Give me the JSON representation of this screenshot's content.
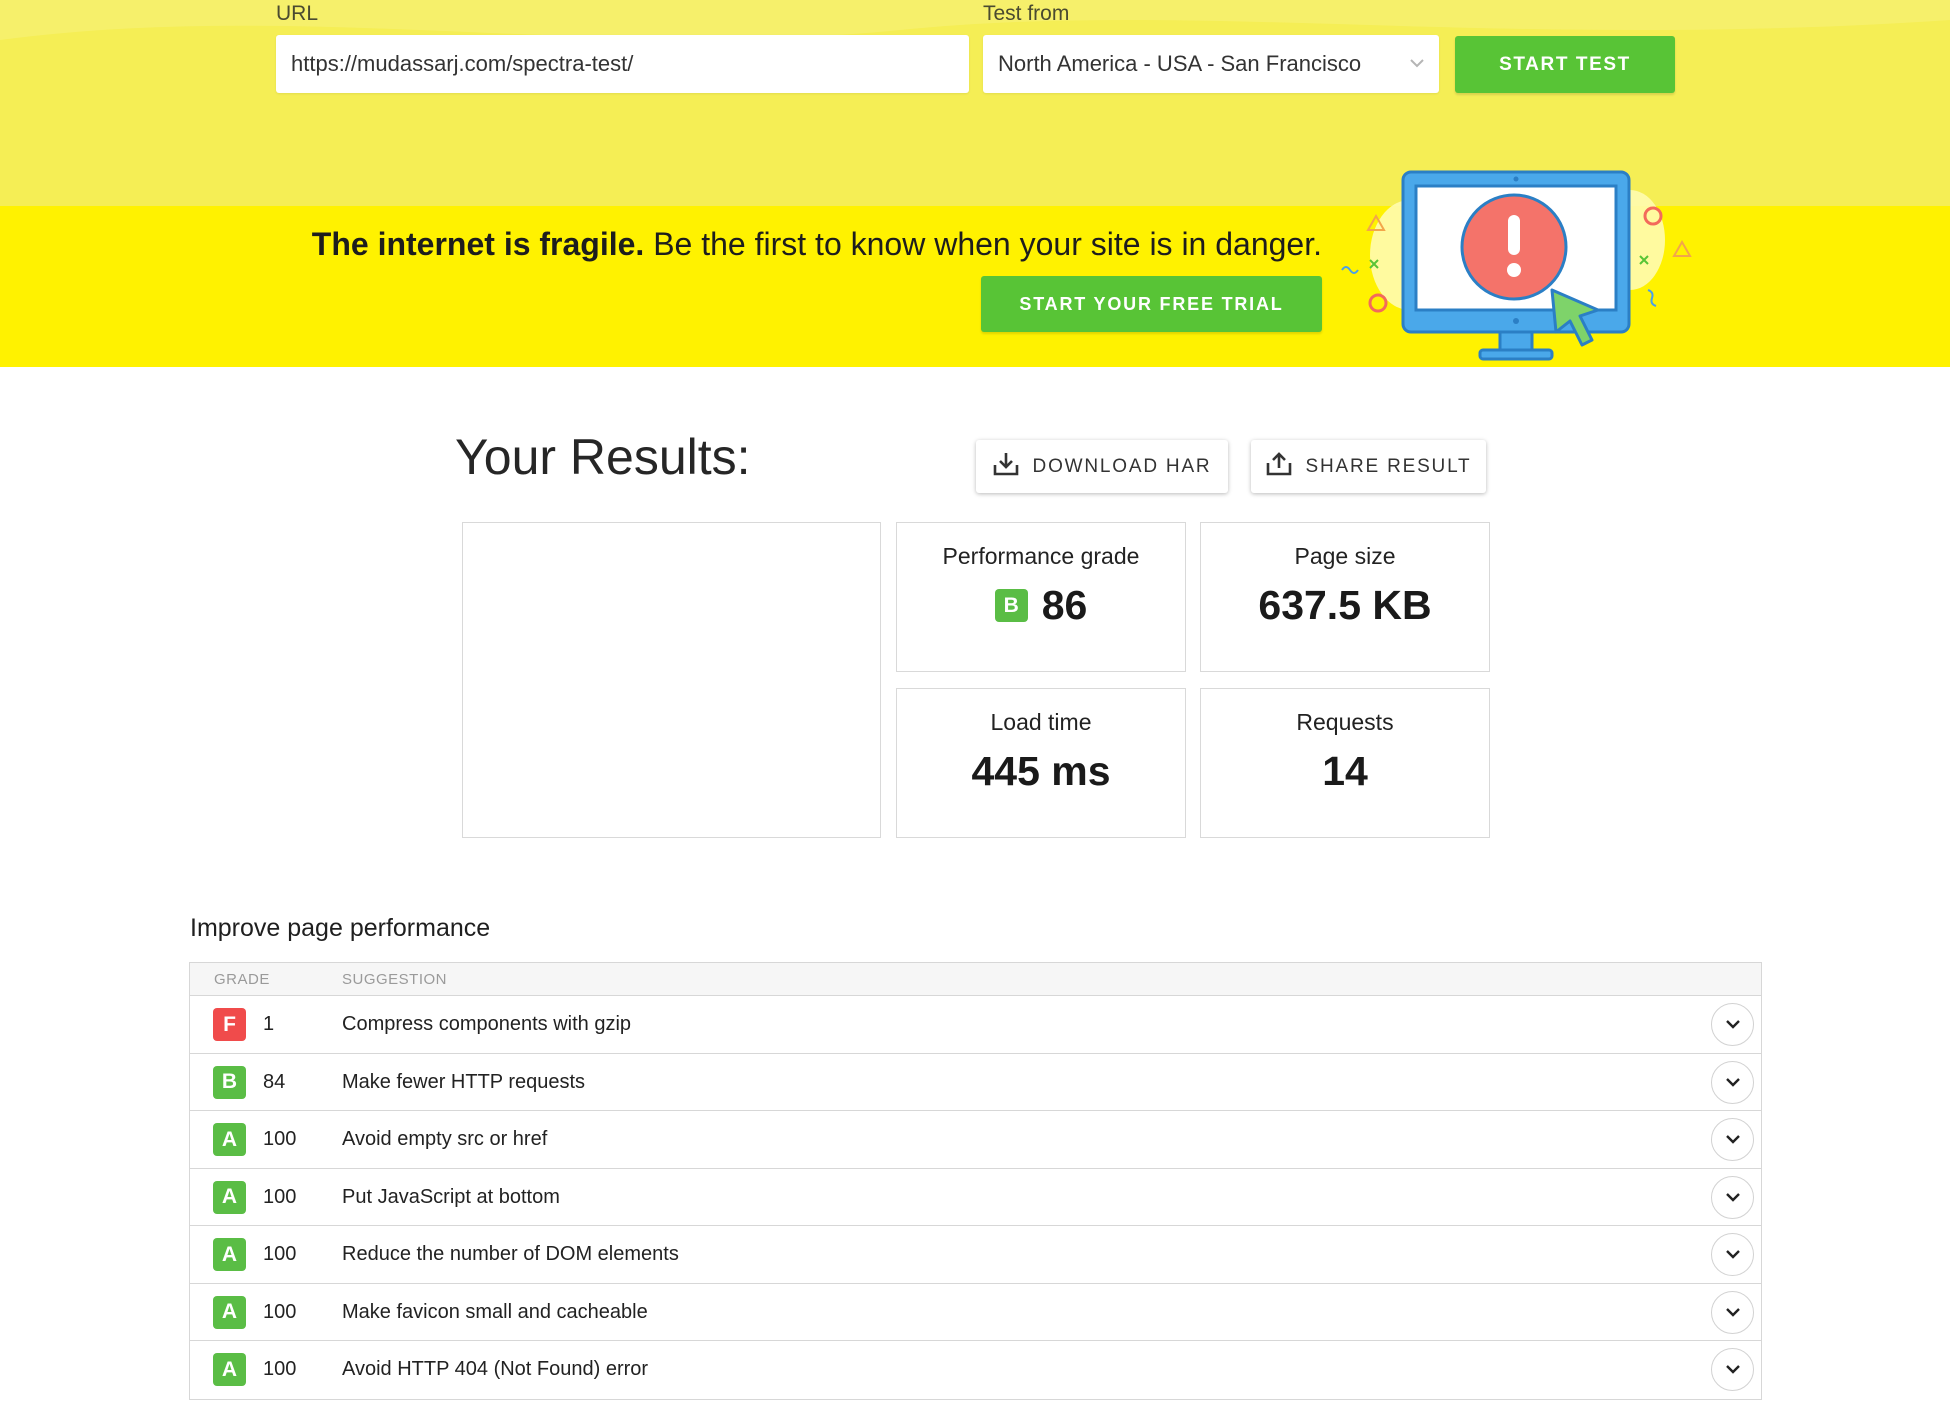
{
  "test_form": {
    "url_label": "URL",
    "url_value": "https://mudassarj.com/spectra-test/",
    "location_label": "Test from",
    "location_value": "North America - USA - San Francisco",
    "start_label": "START TEST"
  },
  "banner": {
    "bold_text": "The internet is fragile.",
    "text": " Be the first to know when your site is in danger.",
    "cta_label": "START YOUR FREE TRIAL"
  },
  "results": {
    "title": "Your Results:",
    "download_label": "DOWNLOAD HAR",
    "share_label": "SHARE RESULT",
    "metrics": {
      "performance": {
        "label": "Performance grade",
        "grade": "B",
        "value": "86"
      },
      "page_size": {
        "label": "Page size",
        "value": "637.5 KB"
      },
      "load_time": {
        "label": "Load time",
        "value": "445 ms"
      },
      "requests": {
        "label": "Requests",
        "value": "14"
      }
    }
  },
  "improve": {
    "title": "Improve page performance",
    "columns": [
      "GRADE",
      "SUGGESTION"
    ],
    "rows": [
      {
        "grade": "F",
        "score": "1",
        "suggestion": "Compress components with gzip"
      },
      {
        "grade": "B",
        "score": "84",
        "suggestion": "Make fewer HTTP requests"
      },
      {
        "grade": "A",
        "score": "100",
        "suggestion": "Avoid empty src or href"
      },
      {
        "grade": "A",
        "score": "100",
        "suggestion": "Put JavaScript at bottom"
      },
      {
        "grade": "A",
        "score": "100",
        "suggestion": "Reduce the number of DOM elements"
      },
      {
        "grade": "A",
        "score": "100",
        "suggestion": "Make favicon small and cacheable"
      },
      {
        "grade": "A",
        "score": "100",
        "suggestion": "Avoid HTTP 404 (Not Found) error"
      }
    ]
  },
  "colors": {
    "accent_green": "#58c436",
    "banner_yellow": "#fff200",
    "header_yellow": "#f5ee55",
    "grade_fail": "#f04b4b",
    "grade_pass": "#5abd45"
  },
  "icons": {
    "download": "download-icon",
    "share": "share-icon",
    "select": "chevron-down-icon",
    "expand": "chevron-down-icon"
  }
}
